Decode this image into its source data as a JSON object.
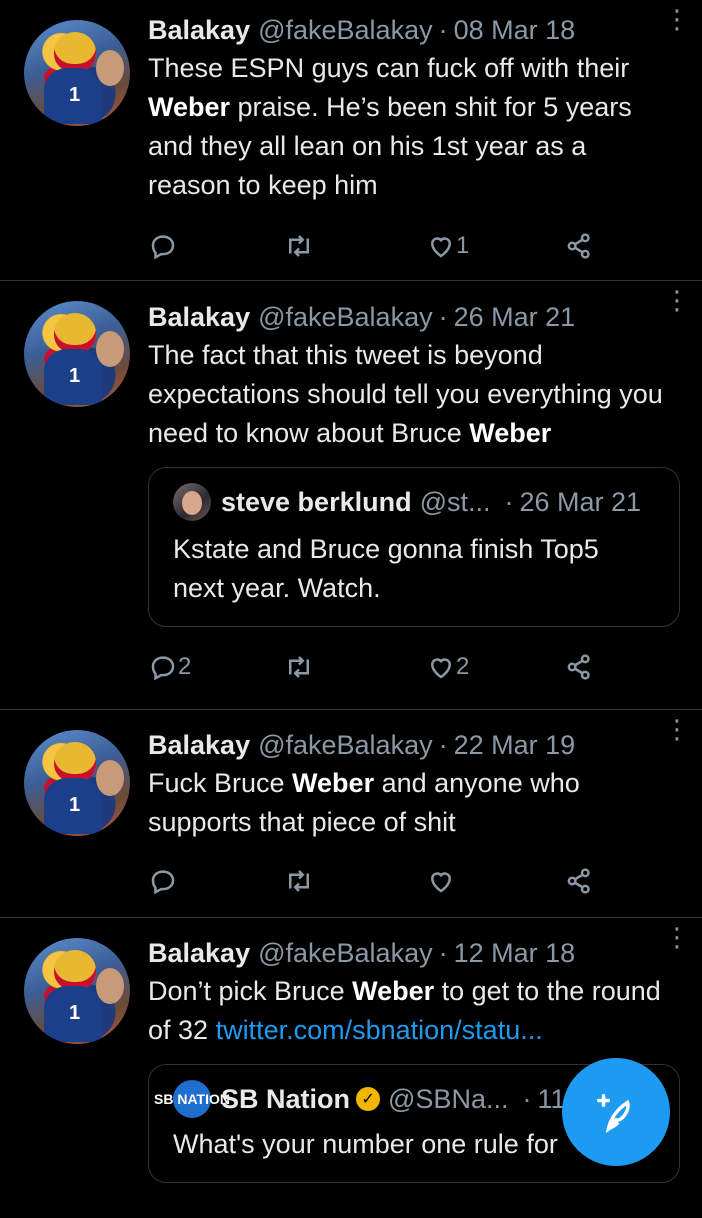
{
  "tweets": [
    {
      "name": "Balakay",
      "handle": "@fakeBalakay",
      "dot": "·",
      "date": "08 Mar 18",
      "text": [
        {
          "t": "These ESPN guys can fuck off with their "
        },
        {
          "t": "Weber",
          "b": true
        },
        {
          "t": " praise. He’s been shit for 5 years and they all lean on his 1st year as a reason to keep him"
        }
      ],
      "reply_count": "",
      "retweet_count": "",
      "like_count": "1"
    },
    {
      "name": "Balakay",
      "handle": "@fakeBalakay",
      "dot": "·",
      "date": "26 Mar 21",
      "text": [
        {
          "t": "The fact that this tweet is beyond expectations should tell you everything you need to know about Bruce "
        },
        {
          "t": "Weber",
          "b": true
        }
      ],
      "quote": {
        "name": "steve berklund",
        "handle": "@st...",
        "dot": "·",
        "date": "26 Mar 21",
        "text": "Kstate and Bruce gonna finish Top5 next year. Watch."
      },
      "reply_count": "2",
      "retweet_count": "",
      "like_count": "2"
    },
    {
      "name": "Balakay",
      "handle": "@fakeBalakay",
      "dot": "·",
      "date": "22 Mar 19",
      "text": [
        {
          "t": "Fuck Bruce "
        },
        {
          "t": "Weber",
          "b": true
        },
        {
          "t": " and anyone who supports that piece of shit"
        }
      ],
      "reply_count": "",
      "retweet_count": "",
      "like_count": ""
    },
    {
      "name": "Balakay",
      "handle": "@fakeBalakay",
      "dot": "·",
      "date": "12 Mar 18",
      "text": [
        {
          "t": "Don’t pick Bruce "
        },
        {
          "t": "Weber",
          "b": true
        },
        {
          "t": " to get to the round of 32 "
        },
        {
          "t": "twitter.com/sbnation/statu...",
          "link": true
        }
      ],
      "quote": {
        "name": "SB Nation",
        "handle": "@SBNa...",
        "dot": "·",
        "date": "11",
        "avatar_text": "SB NATION",
        "verified": true,
        "text": "What's your number one rule for"
      }
    }
  ],
  "icons": {
    "reply": "reply-icon",
    "retweet": "retweet-icon",
    "like": "heart-icon",
    "share": "share-icon",
    "more": "more-vertical-icon",
    "compose": "compose-tweet-icon"
  },
  "colors": {
    "background": "#000000",
    "text": "#e7e9ea",
    "secondary": "#8b98a5",
    "accent": "#1d9bf0",
    "divider": "#2f3336",
    "verified": "#f2b600"
  }
}
